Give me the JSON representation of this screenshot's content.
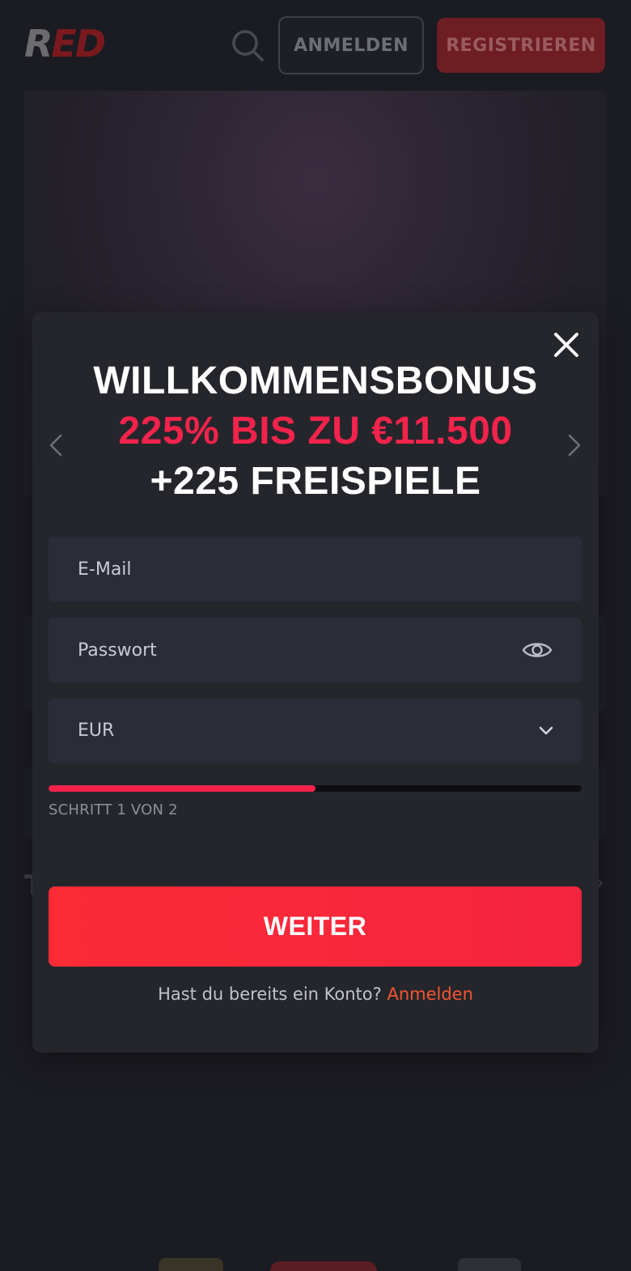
{
  "header": {
    "logo_text": "RED",
    "login_label": "ANMELDEN",
    "register_label": "REGISTRIEREN"
  },
  "background": {
    "partial_letter": "T"
  },
  "modal": {
    "headline_line1": "WILLKOMMENSBONUS",
    "headline_line2": "225% BIS ZU €11.500",
    "headline_line3": "+225 FREISPIELE",
    "email": {
      "value": "",
      "placeholder": "E-Mail"
    },
    "password": {
      "value": "",
      "placeholder": "Passwort"
    },
    "currency": {
      "selected": "EUR"
    },
    "progress": {
      "current_step": 1,
      "total_steps": 2,
      "fraction": 0.5
    },
    "step_label": "SCHRITT 1 VON 2",
    "continue_label": "WEITER",
    "footer_text": "Hast du bereits ein Konto? ",
    "footer_link": "Anmelden"
  },
  "icons": [
    "search-icon",
    "close-icon",
    "chevron-left-icon",
    "chevron-right-icon",
    "eye-icon",
    "chevron-down-icon"
  ],
  "colors": {
    "accent": "#f3234b",
    "button": "#fd2b35",
    "link": "#f55430",
    "modal_bg": "#25262c",
    "field_bg": "#2b2c38",
    "page_bg": "#1b1b22"
  }
}
